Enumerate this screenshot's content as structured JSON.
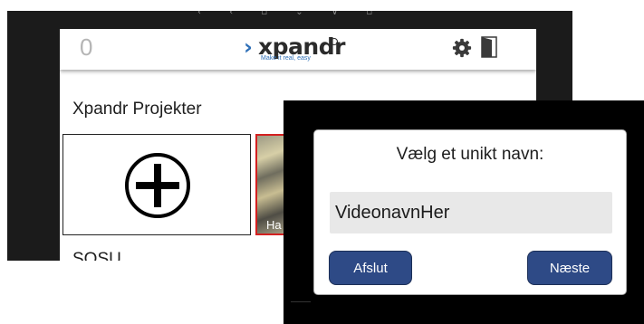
{
  "app": {
    "counter": "0",
    "logo": {
      "wordmark": "xpandr",
      "tagline": "Make it real, easy"
    },
    "icons": [
      "gear-icon",
      "exit-door-icon",
      "plus-circle-icon"
    ],
    "projects_heading": "Xpandr Projekter",
    "thumbnail_label": "Ha",
    "second_heading": "SOSU"
  },
  "dialog": {
    "title": "Vælg et unikt navn:",
    "name_value": "VideonavnHer",
    "cancel_label": "Afslut",
    "next_label": "Næste"
  },
  "colors": {
    "brand_blue": "#2e6fb7",
    "button_blue": "#2e4a86",
    "thumbnail_border": "#d32020"
  }
}
